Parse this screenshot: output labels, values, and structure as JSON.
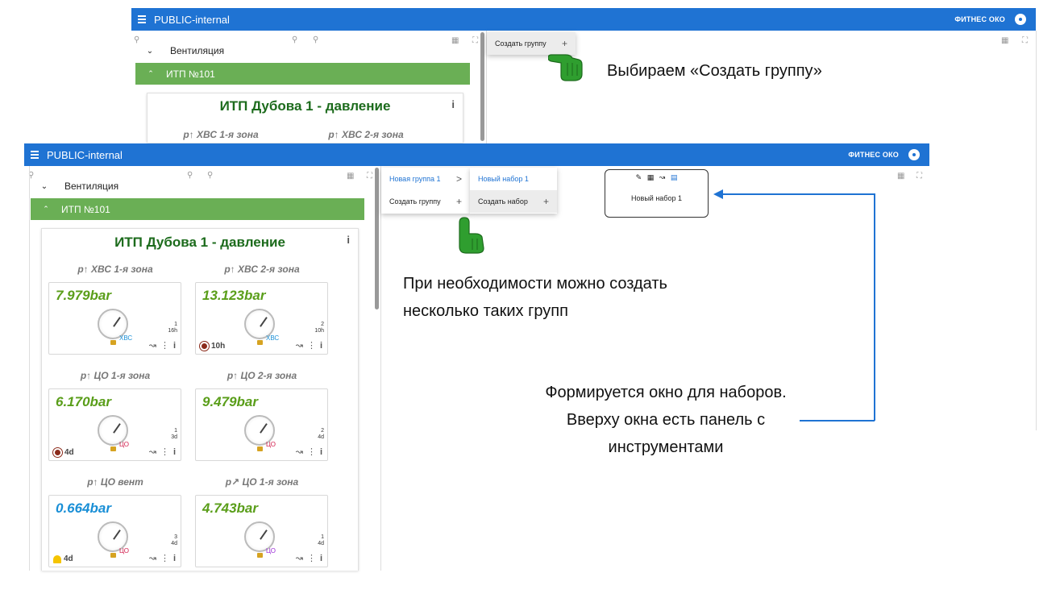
{
  "app": {
    "title": "PUBLIC-internal",
    "brand": "ФИТНЕС ОКО"
  },
  "tree": {
    "group": "Вентиляция",
    "subgroup": "ИТП №101"
  },
  "card": {
    "title": "ИТП Дубова 1 - давление",
    "info": "i"
  },
  "sensors": [
    {
      "label": "p↑ ХВС 1-я зона",
      "value": "7.979bar",
      "medium": "ХВС",
      "meta1": "1",
      "meta2": "16h",
      "alarm": ""
    },
    {
      "label": "p↑ ХВС 2-я зона",
      "value": "13.123bar",
      "medium": "ХВС",
      "meta1": "2",
      "meta2": "10h",
      "alarm": "10h"
    },
    {
      "label": "p↑ ЦО 1-я зона",
      "value": "6.170bar",
      "medium": "ЦО",
      "meta1": "1",
      "meta2": "3d",
      "alarm": "4d"
    },
    {
      "label": "p↑ ЦО 2-я зона",
      "value": "9.479bar",
      "medium": "ЦО",
      "meta1": "2",
      "meta2": "4d",
      "alarm": ""
    },
    {
      "label": "p↑ ЦО вент",
      "value": "0.664bar",
      "medium": "ЦО",
      "meta1": "3",
      "meta2": "4d",
      "alarm": "4d"
    },
    {
      "label": "p↗ ЦО 1-я зона",
      "value": "4.743bar",
      "medium": "ЦО",
      "meta1": "1",
      "meta2": "4d",
      "alarm": ""
    }
  ],
  "menu_top": {
    "create_group": "Создать группу",
    "plus": "+"
  },
  "menu_main": {
    "new_group": "Новая группа 1",
    "chevron": ">",
    "create_group": "Создать группу",
    "plus": "+"
  },
  "menu_sub": {
    "new_set": "Новый набор 1",
    "create_set": "Создать набор",
    "plus": "+"
  },
  "newset_window": {
    "label": "Новый набор 1"
  },
  "callouts": {
    "select_create": "Выбираем «Создать группу»",
    "multiple_line1": "При необходимости можно создать",
    "multiple_line2": "несколько таких групп",
    "window_line1": "Формируется окно для наборов.",
    "window_line2": "Вверху окна есть панель с",
    "window_line3": "инструментами"
  },
  "colors": {
    "appbar": "#1f73d3",
    "green_row": "#6aaf55",
    "value_green": "#5a9e1a",
    "value_blue": "#1a8fd6",
    "medium_blue": "#1a8fd6",
    "medium_red": "#d11a4a",
    "medium_purple": "#9a2ad6",
    "card_title": "#1c6b1c"
  }
}
